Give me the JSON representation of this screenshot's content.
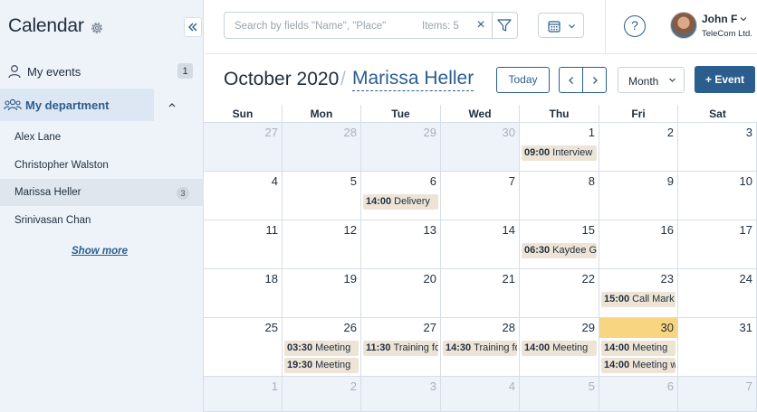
{
  "sidebar": {
    "title": "Calendar",
    "my_events": {
      "label": "My events",
      "count": "1"
    },
    "department": {
      "label": "My department"
    },
    "people": [
      {
        "name": "Alex Lane",
        "count": ""
      },
      {
        "name": "Christopher Walston",
        "count": ""
      },
      {
        "name": "Marissa Heller",
        "count": "3"
      },
      {
        "name": "Srinivasan Chan",
        "count": ""
      }
    ],
    "show_more": "Show more"
  },
  "topbar": {
    "search_placeholder": "Search by fields \"Name\", \"Place\"",
    "items_count": "Items: 5",
    "help": "?",
    "user_name": "John F",
    "user_company": "TeleCom Ltd."
  },
  "toolbar": {
    "month_year": "October 2020",
    "separator": "/",
    "person": "Marissa Heller",
    "today": "Today",
    "view": "Month",
    "new_event": "+ Event"
  },
  "calendar": {
    "weekdays": [
      "Sun",
      "Mon",
      "Tue",
      "Wed",
      "Thu",
      "Fri",
      "Sat"
    ],
    "weeks": [
      [
        {
          "d": "27",
          "o": true
        },
        {
          "d": "28",
          "o": true
        },
        {
          "d": "29",
          "o": true
        },
        {
          "d": "30",
          "o": true
        },
        {
          "d": "1"
        },
        {
          "d": "2"
        },
        {
          "d": "3"
        }
      ],
      [
        {
          "d": "4"
        },
        {
          "d": "5"
        },
        {
          "d": "6"
        },
        {
          "d": "7"
        },
        {
          "d": "8"
        },
        {
          "d": "9"
        },
        {
          "d": "10"
        }
      ],
      [
        {
          "d": "11"
        },
        {
          "d": "12"
        },
        {
          "d": "13"
        },
        {
          "d": "14"
        },
        {
          "d": "15"
        },
        {
          "d": "16"
        },
        {
          "d": "17"
        }
      ],
      [
        {
          "d": "18"
        },
        {
          "d": "19"
        },
        {
          "d": "20"
        },
        {
          "d": "21"
        },
        {
          "d": "22"
        },
        {
          "d": "23"
        },
        {
          "d": "24"
        }
      ],
      [
        {
          "d": "25"
        },
        {
          "d": "26"
        },
        {
          "d": "27"
        },
        {
          "d": "28"
        },
        {
          "d": "29"
        },
        {
          "d": "30",
          "today": true
        },
        {
          "d": "31"
        }
      ],
      [
        {
          "d": "1",
          "o": true
        },
        {
          "d": "2",
          "o": true
        },
        {
          "d": "3",
          "o": true
        },
        {
          "d": "4",
          "o": true
        },
        {
          "d": "5",
          "o": true
        },
        {
          "d": "6",
          "o": true
        },
        {
          "d": "7",
          "o": true
        }
      ]
    ],
    "events": [
      {
        "week": 0,
        "day": 4,
        "slot": 0,
        "time": "09:00",
        "title": "Interview"
      },
      {
        "week": 1,
        "day": 2,
        "slot": 0,
        "time": "14:00",
        "title": "Delivery"
      },
      {
        "week": 2,
        "day": 4,
        "slot": 0,
        "time": "06:30",
        "title": "Kaydee G"
      },
      {
        "week": 3,
        "day": 5,
        "slot": 0,
        "time": "15:00",
        "title": "Call Mark"
      },
      {
        "week": 4,
        "day": 1,
        "slot": 0,
        "time": "03:30",
        "title": "Meeting"
      },
      {
        "week": 4,
        "day": 1,
        "slot": 1,
        "time": "19:30",
        "title": "Meeting"
      },
      {
        "week": 4,
        "day": 2,
        "slot": 0,
        "time": "11:30",
        "title": "Training fo"
      },
      {
        "week": 4,
        "day": 3,
        "slot": 0,
        "time": "14:30",
        "title": "Training fo"
      },
      {
        "week": 4,
        "day": 4,
        "slot": 0,
        "time": "14:00",
        "title": "Meeting"
      },
      {
        "week": 4,
        "day": 5,
        "slot": 0,
        "time": "14:00",
        "title": "Meeting"
      },
      {
        "week": 4,
        "day": 5,
        "slot": 1,
        "time": "14:00",
        "title": "Meeting w"
      }
    ]
  },
  "colors": {
    "accent": "#2b5d8e",
    "today": "#f7d581",
    "event_bg": "#ede4d6",
    "sidebar_bg": "#eef3f9"
  }
}
